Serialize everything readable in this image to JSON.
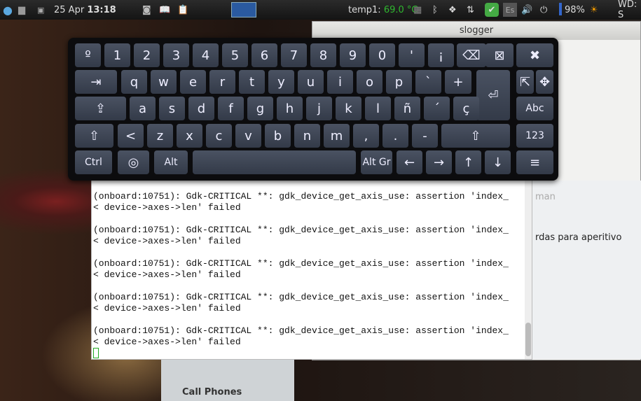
{
  "panel": {
    "date": "25 Apr",
    "time": "13:18",
    "temp_label": "temp1:",
    "temp_value": "69.0 °C",
    "lang": "Es",
    "battery": "98%",
    "weather": "WD: S",
    "temp_color": "#2fb82f"
  },
  "slogger": {
    "title": "slogger"
  },
  "chat": {
    "visible_text": "rdas para aperitivo",
    "partial": "man"
  },
  "bottom": {
    "label": "Call Phones"
  },
  "terminal": {
    "lines": [
      "(onboard:10751): Gdk-CRITICAL **: gdk_device_get_axis_use: assertion 'index_",
      "< device->axes->len' failed",
      "",
      "(onboard:10751): Gdk-CRITICAL **: gdk_device_get_axis_use: assertion 'index_",
      "< device->axes->len' failed",
      "",
      "(onboard:10751): Gdk-CRITICAL **: gdk_device_get_axis_use: assertion 'index_",
      "< device->axes->len' failed",
      "",
      "(onboard:10751): Gdk-CRITICAL **: gdk_device_get_axis_use: assertion 'index_",
      "< device->axes->len' failed",
      "",
      "(onboard:10751): Gdk-CRITICAL **: gdk_device_get_axis_use: assertion 'index_",
      "< device->axes->len' failed"
    ]
  },
  "keyboard": {
    "rows": [
      [
        "º",
        "1",
        "2",
        "3",
        "4",
        "5",
        "6",
        "7",
        "8",
        "9",
        "0",
        "'",
        "¡",
        "⌫",
        "⊠",
        "✖"
      ],
      [
        "⇥",
        "q",
        "w",
        "e",
        "r",
        "t",
        "y",
        "u",
        "i",
        "o",
        "p",
        "`",
        "+",
        "⏎",
        "⇱",
        "✥"
      ],
      [
        "⇪",
        "a",
        "s",
        "d",
        "f",
        "g",
        "h",
        "j",
        "k",
        "l",
        "ñ",
        "´",
        "ç",
        "Abc"
      ],
      [
        "⇧",
        "<",
        "z",
        "x",
        "c",
        "v",
        "b",
        "n",
        "m",
        ",",
        ".",
        "-",
        "⇧",
        "123"
      ],
      [
        "Ctrl",
        "◎",
        "Alt",
        "",
        "Alt Gr",
        "←",
        "→",
        "↑",
        "↓",
        "≡"
      ]
    ]
  }
}
